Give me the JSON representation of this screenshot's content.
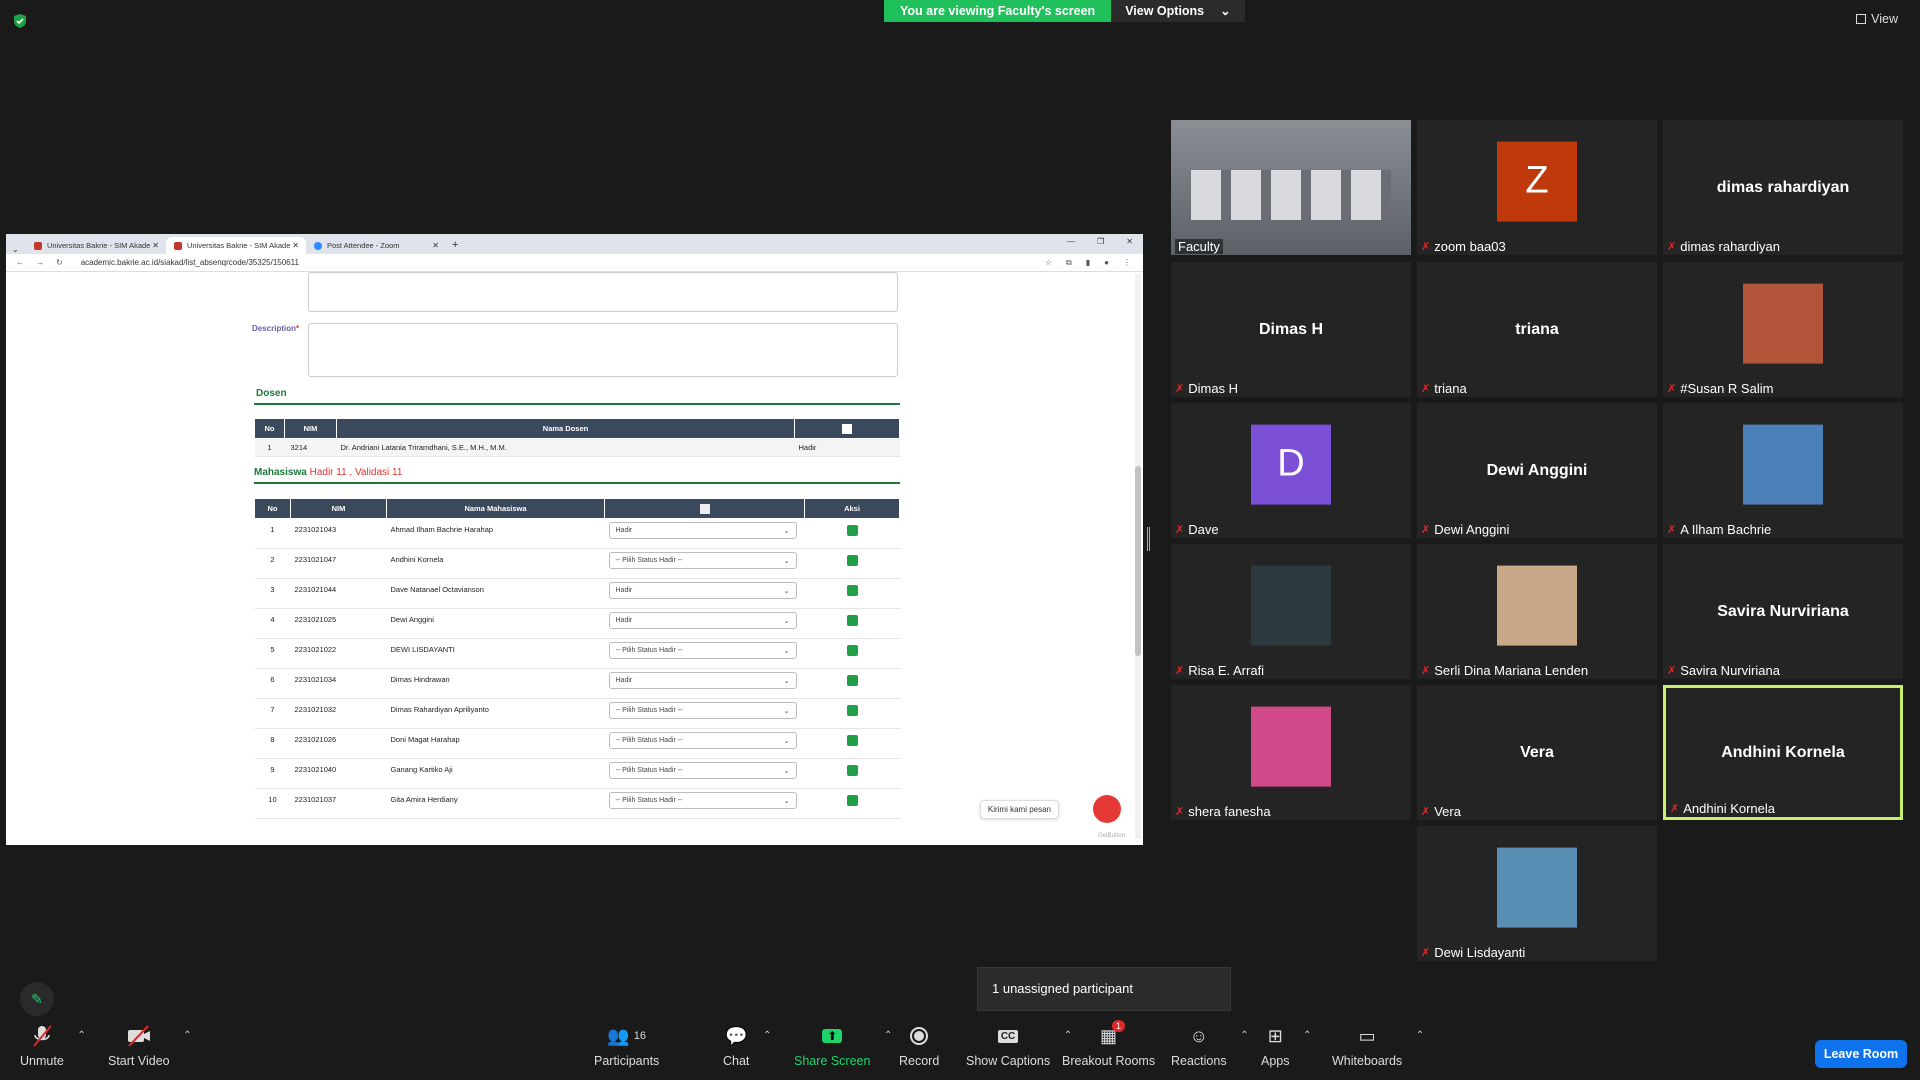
{
  "banner": {
    "viewing": "You are viewing Faculty's screen",
    "view_options": "View Options",
    "view": "View"
  },
  "browser": {
    "tabs": [
      "Universitas Bakrie - SIM Akade",
      "Universitas Bakrie - SIM Akade",
      "Post Attendee - Zoom"
    ],
    "url": "academic.bakrie.ac.id/siakad/list_absenqrcode/35325/150611",
    "description_label": "Description",
    "dosen_title": "Dosen",
    "dosen_headers": [
      "No",
      "NIM",
      "Nama Dosen"
    ],
    "dosen_row": {
      "no": "1",
      "nim": "3214",
      "nama": "Dr. Andriani Latania Triramdhani, S.E., M.H., M.M.",
      "status": "Hadir"
    },
    "mhs_title": "Mahasiswa",
    "mhs_hadir": "Hadir  11",
    "mhs_valid": "Validasi  11",
    "mhs_sep": " , ",
    "mhs_headers": [
      "No",
      "NIM",
      "Nama Mahasiswa",
      "Aksi"
    ],
    "mhs_rows": [
      {
        "no": "1",
        "nim": "2231021043",
        "nama": "Ahmad Ilham Bachrie Harahap",
        "status": "Hadir"
      },
      {
        "no": "2",
        "nim": "2231021047",
        "nama": "Andhini Kornela",
        "status": "-- Pilih Status Hadir --"
      },
      {
        "no": "3",
        "nim": "2231021044",
        "nama": "Dave Natanael Octavianson",
        "status": "Hadir"
      },
      {
        "no": "4",
        "nim": "2231021025",
        "nama": "Dewi Anggini",
        "status": "Hadir"
      },
      {
        "no": "5",
        "nim": "2231021022",
        "nama": "DEWI LISDAYANTI",
        "status": "-- Pilih Status Hadir --"
      },
      {
        "no": "6",
        "nim": "2231021034",
        "nama": "Dimas Hindrawan",
        "status": "Hadir"
      },
      {
        "no": "7",
        "nim": "2231021032",
        "nama": "Dimas Rahardiyan Apriliyanto",
        "status": "-- Pilih Status Hadir --"
      },
      {
        "no": "8",
        "nim": "2231021026",
        "nama": "Doni Magat Harahap",
        "status": "-- Pilih Status Hadir --"
      },
      {
        "no": "9",
        "nim": "2231021040",
        "nama": "Ganang Kartiko Aji",
        "status": "-- Pilih Status Hadir --"
      },
      {
        "no": "10",
        "nim": "2231021037",
        "nama": "Gita Amira Herdiany",
        "status": "-- Pilih Status Hadir --"
      }
    ],
    "kirimi": "Kirimi kami pesan",
    "getbutton": "GetButton"
  },
  "participants": [
    {
      "name": "Faculty",
      "type": "video"
    },
    {
      "name": "zoom baa03",
      "initial": "Z",
      "color": "#c0390b",
      "type": "initial"
    },
    {
      "name": "dimas rahardiyan",
      "type": "name"
    },
    {
      "name": "Dimas H",
      "type": "name"
    },
    {
      "name": "triana",
      "type": "name"
    },
    {
      "name": "#Susan R Salim",
      "type": "photo"
    },
    {
      "name": "Dave",
      "initial": "D",
      "color": "#7b4fd6",
      "type": "initial"
    },
    {
      "name": "Dewi Anggini",
      "type": "name"
    },
    {
      "name": "A Ilham Bachrie",
      "type": "photo"
    },
    {
      "name": "Risa E. Arrafi",
      "type": "photo"
    },
    {
      "name": "Serli Dina Mariana Lenden",
      "type": "photo"
    },
    {
      "name": "Savira Nurviriana",
      "type": "name"
    },
    {
      "name": "shera fanesha",
      "type": "photo"
    },
    {
      "name": "Vera",
      "type": "name"
    },
    {
      "name": "Andhini Kornela",
      "type": "name"
    },
    {
      "name": "Dewi Lisdayanti",
      "type": "photo"
    }
  ],
  "toast": "1 unassigned participant",
  "toolbar": {
    "unmute": "Unmute",
    "start_video": "Start Video",
    "participants": "Participants",
    "participants_count": "16",
    "chat": "Chat",
    "share_screen": "Share Screen",
    "record": "Record",
    "cc": "CC",
    "show_captions": "Show Captions",
    "breakout_rooms": "Breakout Rooms",
    "breakout_badge": "1",
    "reactions": "Reactions",
    "apps": "Apps",
    "whiteboards": "Whiteboards",
    "leave": "Leave Room"
  }
}
